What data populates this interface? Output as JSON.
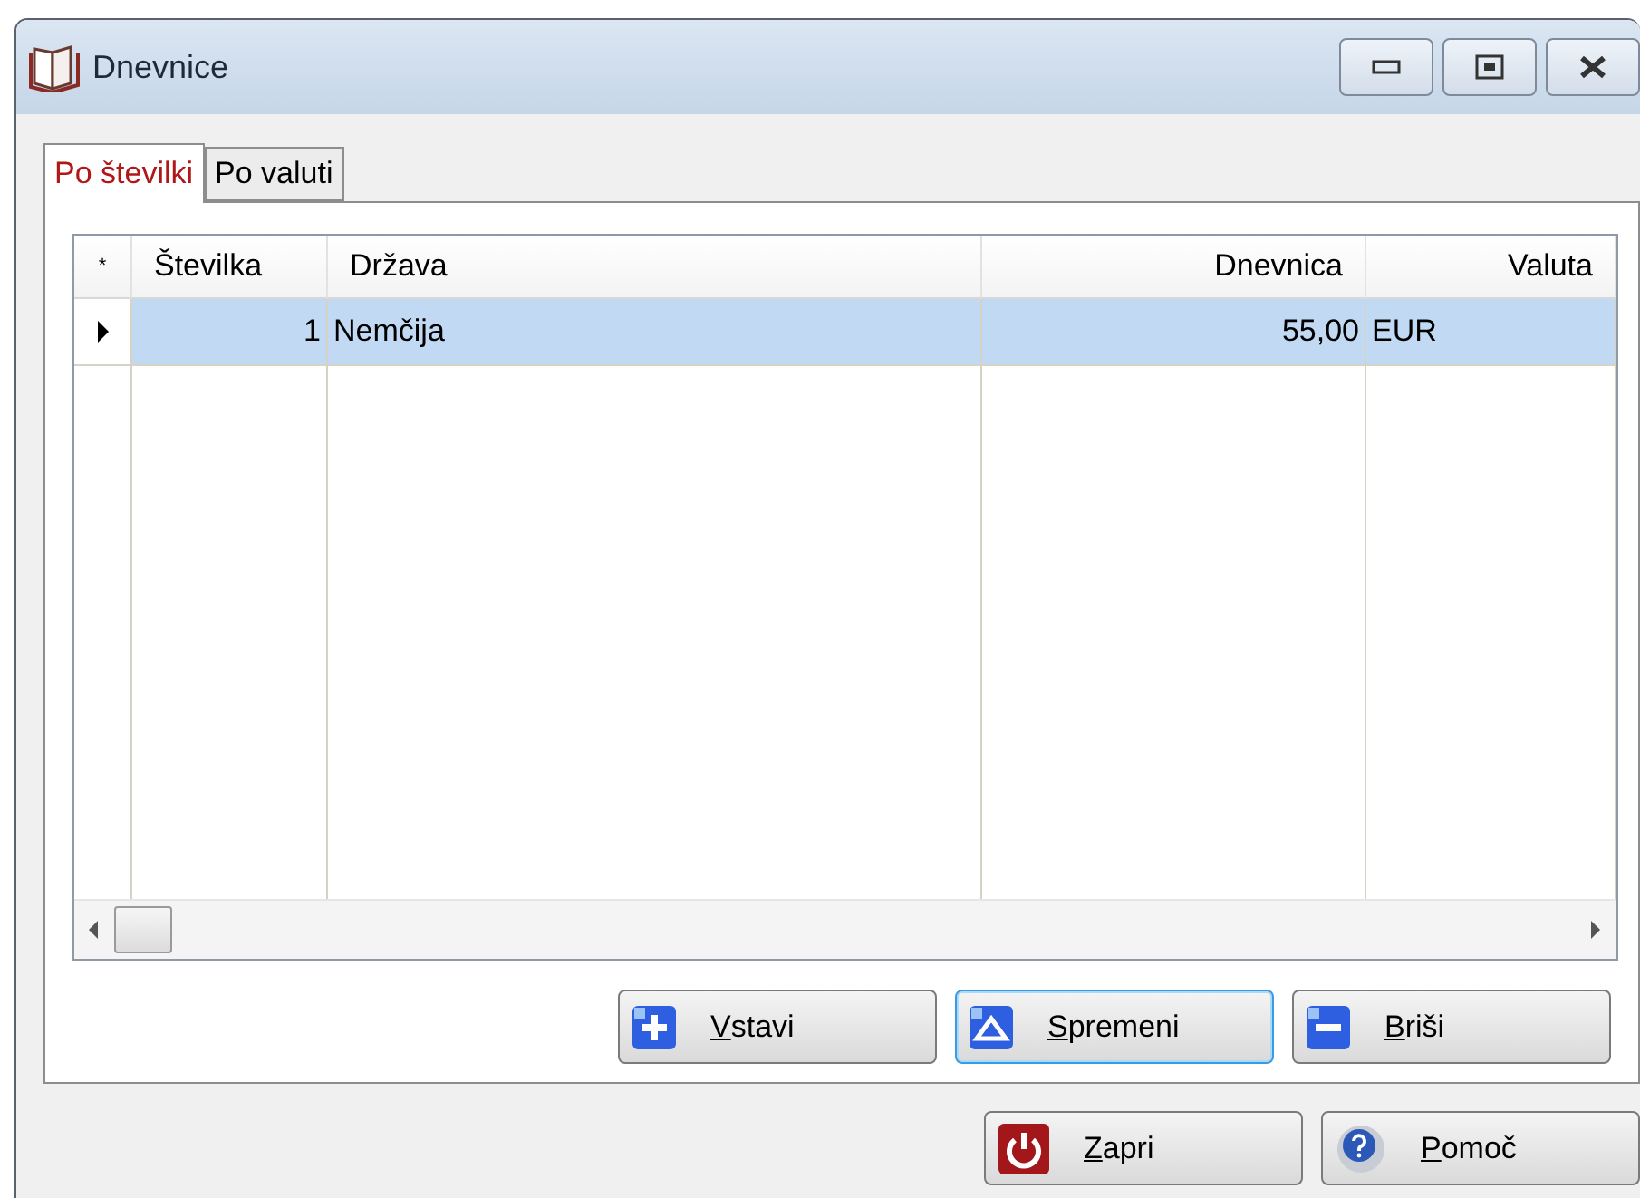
{
  "window": {
    "title": "Dnevnice"
  },
  "tabs": [
    {
      "label": "Po številki",
      "selected": true
    },
    {
      "label": "Po valuti",
      "selected": false
    }
  ],
  "table": {
    "columns": [
      {
        "label": "Številka"
      },
      {
        "label": "Država"
      },
      {
        "label": "Dnevnica"
      },
      {
        "label": "Valuta"
      }
    ],
    "new_row_marker": "*",
    "rows": [
      {
        "selected": true,
        "cells": [
          "1",
          "Nemčija",
          "55,00",
          "EUR"
        ]
      }
    ]
  },
  "actions": [
    {
      "label": "Vstavi",
      "kind": "plus",
      "focused": false,
      "mnemonic": true
    },
    {
      "label": "Spremeni",
      "kind": "edit",
      "focused": true,
      "mnemonic": true
    },
    {
      "label": "Briši",
      "kind": "minus",
      "focused": false,
      "mnemonic": true
    }
  ],
  "footer_buttons": [
    {
      "label": "Zapri",
      "kind": "power",
      "mnemonic": true
    },
    {
      "label": "Pomoč",
      "kind": "help",
      "mnemonic": true
    }
  ]
}
